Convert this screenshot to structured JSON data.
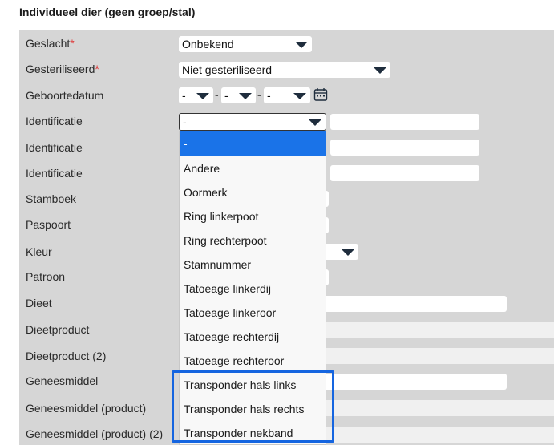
{
  "section_title": "Individueel dier (geen groep/stal)",
  "fields": {
    "geslacht": {
      "label": "Geslacht",
      "required": true,
      "value": "Onbekend"
    },
    "gesteriliseerd": {
      "label": "Gesteriliseerd",
      "required": true,
      "value": "Niet gesteriliseerd"
    },
    "geboortedatum": {
      "label": "Geboortedatum",
      "day": "-",
      "month": "-",
      "year": "-"
    },
    "identificatie1": {
      "label": "Identificatie",
      "value": "-"
    },
    "identificatie2": {
      "label": "Identificatie"
    },
    "identificatie3": {
      "label": "Identificatie"
    },
    "stamboek": {
      "label": "Stamboek"
    },
    "paspoort": {
      "label": "Paspoort"
    },
    "kleur": {
      "label": "Kleur"
    },
    "patroon": {
      "label": "Patroon"
    },
    "dieet": {
      "label": "Dieet"
    },
    "dieetproduct": {
      "label": "Dieetproduct"
    },
    "dieetproduct2": {
      "label": "Dieetproduct (2)"
    },
    "geneesmiddel": {
      "label": "Geneesmiddel"
    },
    "geneesmiddel_product": {
      "label": "Geneesmiddel (product)"
    },
    "geneesmiddel_product2": {
      "label": "Geneesmiddel (product) (2)"
    }
  },
  "required_mark": "*",
  "dropdown": {
    "options": [
      "-",
      "Andere",
      "Oormerk",
      "Ring linkerpoot",
      "Ring rechterpoot",
      "Stamnummer",
      "Tatoeage linkerdij",
      "Tatoeage linkeroor",
      "Tatoeage rechterdij",
      "Tatoeage rechteroor",
      "Transponder hals links",
      "Transponder hals rechts",
      "Transponder nekband"
    ],
    "selected_index": 0
  },
  "colors": {
    "selection": "#1a73e8",
    "highlight_box": "#1565e0",
    "panel": "#d6d6d6",
    "required": "#e03030"
  }
}
